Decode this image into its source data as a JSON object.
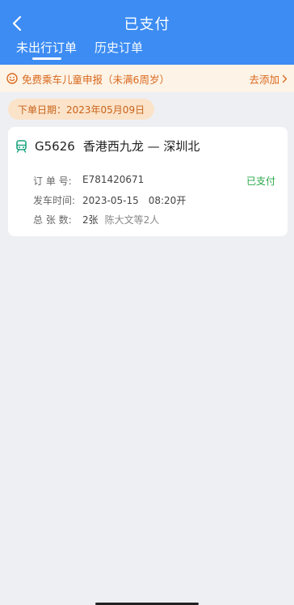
{
  "header": {
    "title": "已支付",
    "tabs": [
      {
        "label": "未出行订单",
        "active": true
      },
      {
        "label": "历史订单",
        "active": false
      }
    ]
  },
  "notice": {
    "text": "免费乘车儿童申报（未满6周岁）",
    "action": "去添加"
  },
  "order_date": "下单日期：2023年05月09日",
  "order": {
    "train": "G5626",
    "route": "香港西九龙 — 深圳北",
    "status": "已支付",
    "order_no_label": "订 单 号:",
    "order_no": "E781420671",
    "depart_label": "发车时间:",
    "depart_time": "2023-05-15　08:20开",
    "count_label": "总 张 数:",
    "count": "2张",
    "passengers": "陈大文等2人"
  },
  "colors": {
    "header_bg": "#3c8cf3",
    "notice_text": "#d9691e",
    "status_green": "#2aa84a"
  }
}
